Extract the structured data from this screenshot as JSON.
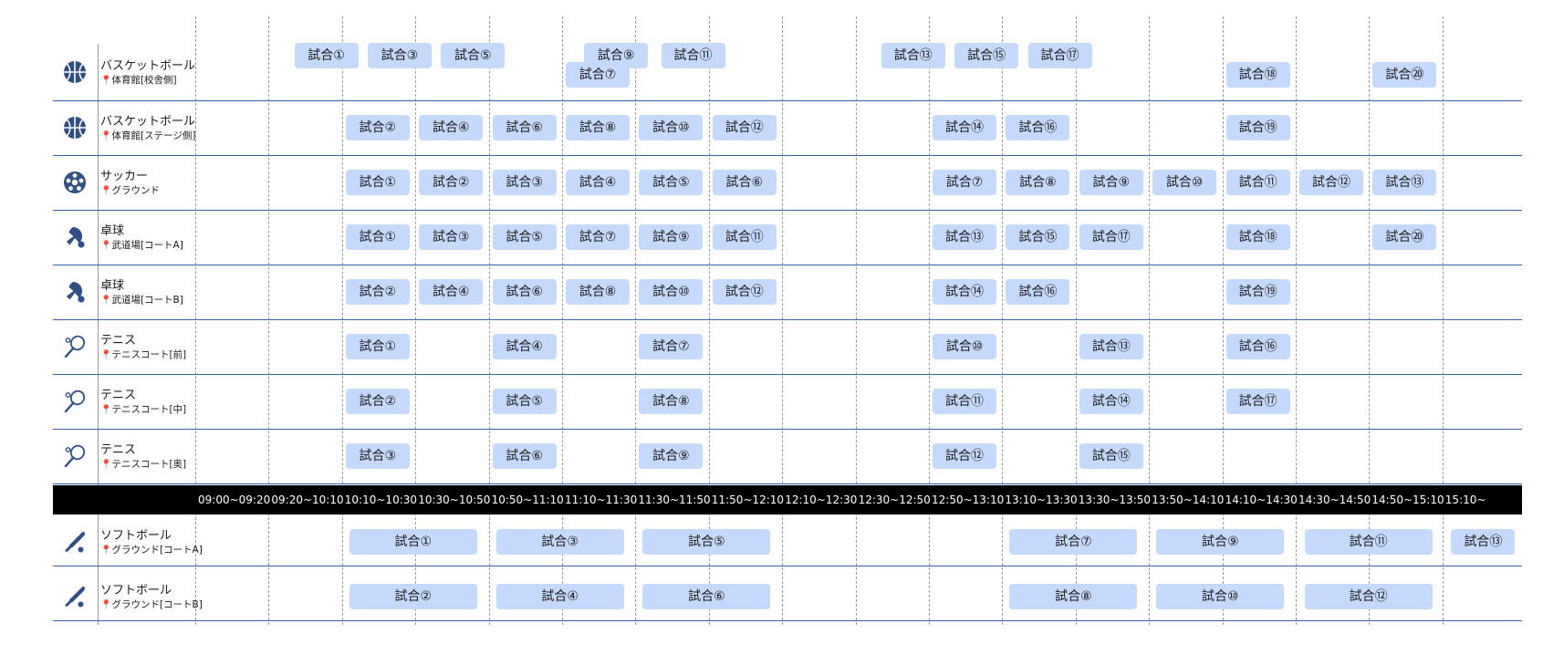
{
  "accent_color": "#c4d9fb",
  "line_color": "#3a5fb0",
  "time_slots": [
    "09:00~09:20",
    "09:20~10:10",
    "10:10~10:30",
    "10:30~10:50",
    "10:50~11:10",
    "11:10~11:30",
    "11:30~11:50",
    "11:50~12:10",
    "12:10~12:30",
    "12:30~12:50",
    "12:50~13:10",
    "13:10~13:30",
    "13:30~13:50",
    "13:50~14:10",
    "14:10~14:30",
    "14:30~14:50",
    "14:50~15:10",
    "15:10~"
  ],
  "rows_top": [
    {
      "icon": "basketball-icon",
      "sport": "バスケットボール",
      "venue": "体育館[校舎側]",
      "matches": [
        {
          "label": "試合①",
          "slot": 1.35
        },
        {
          "label": "試合③",
          "slot": 2.35
        },
        {
          "label": "試合⑤",
          "slot": 3.35
        },
        {
          "label": "試合⑨",
          "slot": 5.3
        },
        {
          "label": "試合⑦",
          "slot": 5.05,
          "stack": "low"
        },
        {
          "label": "試合⑪",
          "slot": 6.35
        },
        {
          "label": "試合⑬",
          "slot": 9.35
        },
        {
          "label": "試合⑮",
          "slot": 10.35
        },
        {
          "label": "試合⑰",
          "slot": 11.35
        },
        {
          "label": "試合⑱",
          "slot": 14.05,
          "stack": "low"
        },
        {
          "label": "試合⑳",
          "slot": 16.05,
          "stack": "low"
        }
      ]
    },
    {
      "icon": "basketball-icon",
      "sport": "バスケットボール",
      "venue": "体育館[ステージ側]",
      "matches": [
        {
          "label": "試合②",
          "slot": 2.05
        },
        {
          "label": "試合④",
          "slot": 3.05
        },
        {
          "label": "試合⑥",
          "slot": 4.05
        },
        {
          "label": "試合⑧",
          "slot": 5.05
        },
        {
          "label": "試合⑩",
          "slot": 6.05
        },
        {
          "label": "試合⑫",
          "slot": 7.05
        },
        {
          "label": "試合⑭",
          "slot": 10.05
        },
        {
          "label": "試合⑯",
          "slot": 11.05
        },
        {
          "label": "試合⑲",
          "slot": 14.05
        }
      ]
    },
    {
      "icon": "soccer-ball-icon",
      "sport": "サッカー",
      "venue": "グラウンド",
      "matches": [
        {
          "label": "試合①",
          "slot": 2.05
        },
        {
          "label": "試合②",
          "slot": 3.05
        },
        {
          "label": "試合③",
          "slot": 4.05
        },
        {
          "label": "試合④",
          "slot": 5.05
        },
        {
          "label": "試合⑤",
          "slot": 6.05
        },
        {
          "label": "試合⑥",
          "slot": 7.05
        },
        {
          "label": "試合⑦",
          "slot": 10.05
        },
        {
          "label": "試合⑧",
          "slot": 11.05
        },
        {
          "label": "試合⑨",
          "slot": 12.05
        },
        {
          "label": "試合⑩",
          "slot": 13.05
        },
        {
          "label": "試合⑪",
          "slot": 14.05
        },
        {
          "label": "試合⑫",
          "slot": 15.05
        },
        {
          "label": "試合⑬",
          "slot": 16.05
        }
      ]
    },
    {
      "icon": "ping-pong-icon",
      "sport": "卓球",
      "venue": "武道場[コートA]",
      "matches": [
        {
          "label": "試合①",
          "slot": 2.05
        },
        {
          "label": "試合③",
          "slot": 3.05
        },
        {
          "label": "試合⑤",
          "slot": 4.05
        },
        {
          "label": "試合⑦",
          "slot": 5.05
        },
        {
          "label": "試合⑨",
          "slot": 6.05
        },
        {
          "label": "試合⑪",
          "slot": 7.05
        },
        {
          "label": "試合⑬",
          "slot": 10.05
        },
        {
          "label": "試合⑮",
          "slot": 11.05
        },
        {
          "label": "試合⑰",
          "slot": 12.05
        },
        {
          "label": "試合⑱",
          "slot": 14.05
        },
        {
          "label": "試合⑳",
          "slot": 16.05
        }
      ]
    },
    {
      "icon": "ping-pong-icon",
      "sport": "卓球",
      "venue": "武道場[コートB]",
      "matches": [
        {
          "label": "試合②",
          "slot": 2.05
        },
        {
          "label": "試合④",
          "slot": 3.05
        },
        {
          "label": "試合⑥",
          "slot": 4.05
        },
        {
          "label": "試合⑧",
          "slot": 5.05
        },
        {
          "label": "試合⑩",
          "slot": 6.05
        },
        {
          "label": "試合⑫",
          "slot": 7.05
        },
        {
          "label": "試合⑭",
          "slot": 10.05
        },
        {
          "label": "試合⑯",
          "slot": 11.05
        },
        {
          "label": "試合⑲",
          "slot": 14.05
        }
      ]
    },
    {
      "icon": "tennis-racket-icon",
      "sport": "テニス",
      "venue": "テニスコート[前]",
      "matches": [
        {
          "label": "試合①",
          "slot": 2.05
        },
        {
          "label": "試合④",
          "slot": 4.05
        },
        {
          "label": "試合⑦",
          "slot": 6.05
        },
        {
          "label": "試合⑩",
          "slot": 10.05
        },
        {
          "label": "試合⑬",
          "slot": 12.05
        },
        {
          "label": "試合⑯",
          "slot": 14.05
        }
      ]
    },
    {
      "icon": "tennis-racket-icon",
      "sport": "テニス",
      "venue": "テニスコート[中]",
      "matches": [
        {
          "label": "試合②",
          "slot": 2.05
        },
        {
          "label": "試合⑤",
          "slot": 4.05
        },
        {
          "label": "試合⑧",
          "slot": 6.05
        },
        {
          "label": "試合⑪",
          "slot": 10.05
        },
        {
          "label": "試合⑭",
          "slot": 12.05
        },
        {
          "label": "試合⑰",
          "slot": 14.05
        }
      ]
    },
    {
      "icon": "tennis-racket-icon",
      "sport": "テニス",
      "venue": "テニスコート[奥]",
      "matches": [
        {
          "label": "試合③",
          "slot": 2.05
        },
        {
          "label": "試合⑥",
          "slot": 4.05
        },
        {
          "label": "試合⑨",
          "slot": 6.05
        },
        {
          "label": "試合⑫",
          "slot": 10.05
        },
        {
          "label": "試合⑮",
          "slot": 12.05
        }
      ]
    }
  ],
  "rows_bottom": [
    {
      "icon": "softball-bat-icon",
      "sport": "ソフトボール",
      "venue": "グラウンド[コートA]",
      "matches": [
        {
          "label": "試合①",
          "slot": 2.1,
          "wide": true
        },
        {
          "label": "試合③",
          "slot": 4.1,
          "wide": true
        },
        {
          "label": "試合⑤",
          "slot": 6.1,
          "wide": true
        },
        {
          "label": "試合⑦",
          "slot": 11.1,
          "wide": true
        },
        {
          "label": "試合⑨",
          "slot": 13.1,
          "wide": true
        },
        {
          "label": "試合⑪",
          "slot": 15.12,
          "wide": true
        },
        {
          "label": "試合⑬",
          "slot": 17.12
        }
      ]
    },
    {
      "icon": "softball-bat-icon",
      "sport": "ソフトボール",
      "venue": "グラウンド[コートB]",
      "matches": [
        {
          "label": "試合②",
          "slot": 2.1,
          "wide": true
        },
        {
          "label": "試合④",
          "slot": 4.1,
          "wide": true
        },
        {
          "label": "試合⑥",
          "slot": 6.1,
          "wide": true
        },
        {
          "label": "試合⑧",
          "slot": 11.1,
          "wide": true
        },
        {
          "label": "試合⑩",
          "slot": 13.1,
          "wide": true
        },
        {
          "label": "試合⑫",
          "slot": 15.12,
          "wide": true
        }
      ]
    }
  ]
}
